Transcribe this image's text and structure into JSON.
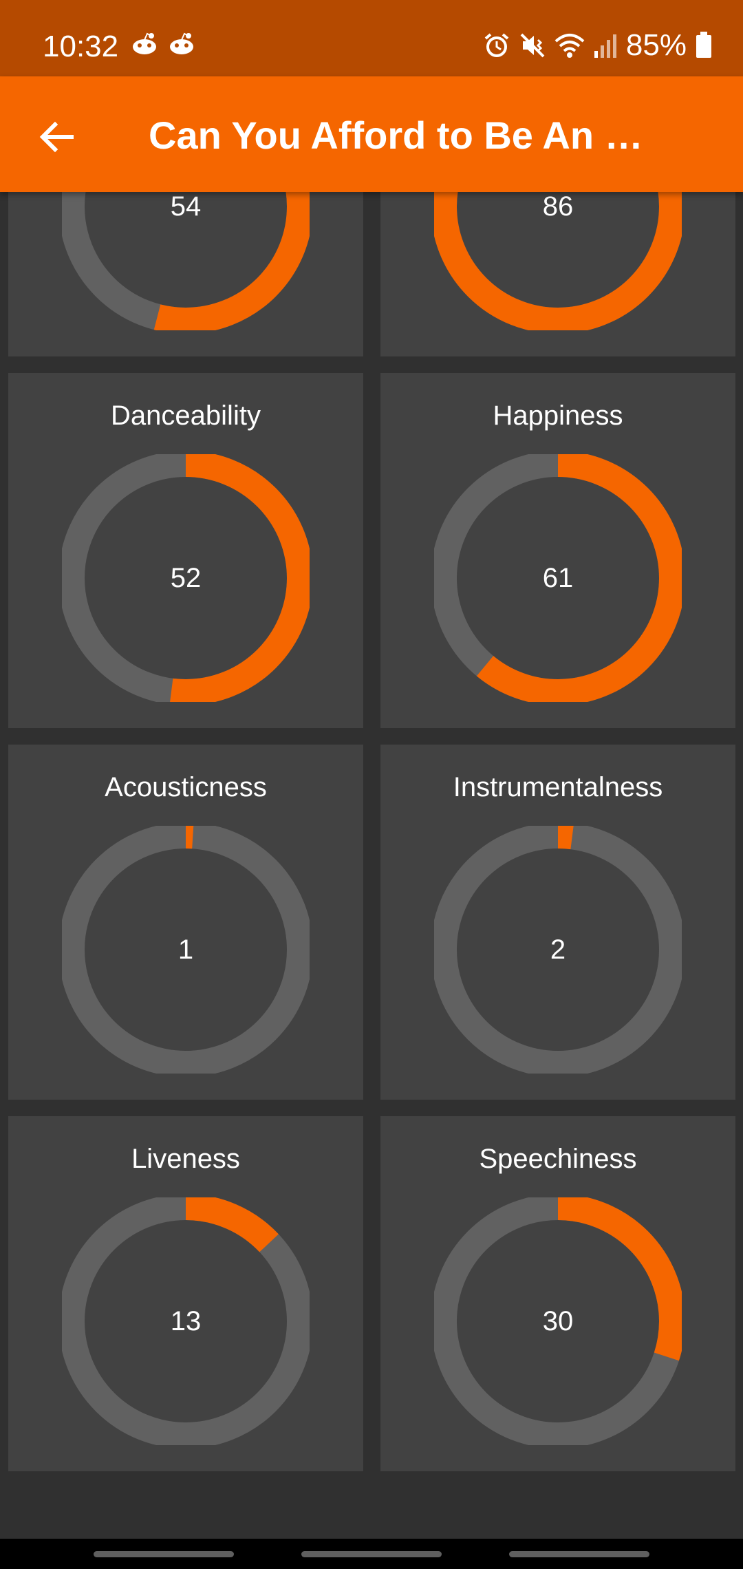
{
  "status_bar": {
    "time": "10:32",
    "battery_percent": "85%",
    "left_icons": [
      "reddit-icon",
      "reddit-icon"
    ],
    "right_icons": [
      "alarm-icon",
      "mute-vibrate-icon",
      "wifi-icon",
      "signal-icon",
      "battery-icon"
    ]
  },
  "app_bar": {
    "title": "Can You Afford to Be An …",
    "back_icon": "arrow-back-icon"
  },
  "colors": {
    "accent": "#F56600",
    "status_bar": "#B54A00",
    "card": "#424242",
    "background": "#303030",
    "ring_track": "#616161"
  },
  "metrics": [
    {
      "label": "",
      "value": "54",
      "percent": 54
    },
    {
      "label": "",
      "value": "86",
      "percent": 86
    },
    {
      "label": "Danceability",
      "value": "52",
      "percent": 52
    },
    {
      "label": "Happiness",
      "value": "61",
      "percent": 61
    },
    {
      "label": "Acousticness",
      "value": "1",
      "percent": 1
    },
    {
      "label": "Instrumentalness",
      "value": "2",
      "percent": 2
    },
    {
      "label": "Liveness",
      "value": "13",
      "percent": 13
    },
    {
      "label": "Speechiness",
      "value": "30",
      "percent": 30
    }
  ]
}
